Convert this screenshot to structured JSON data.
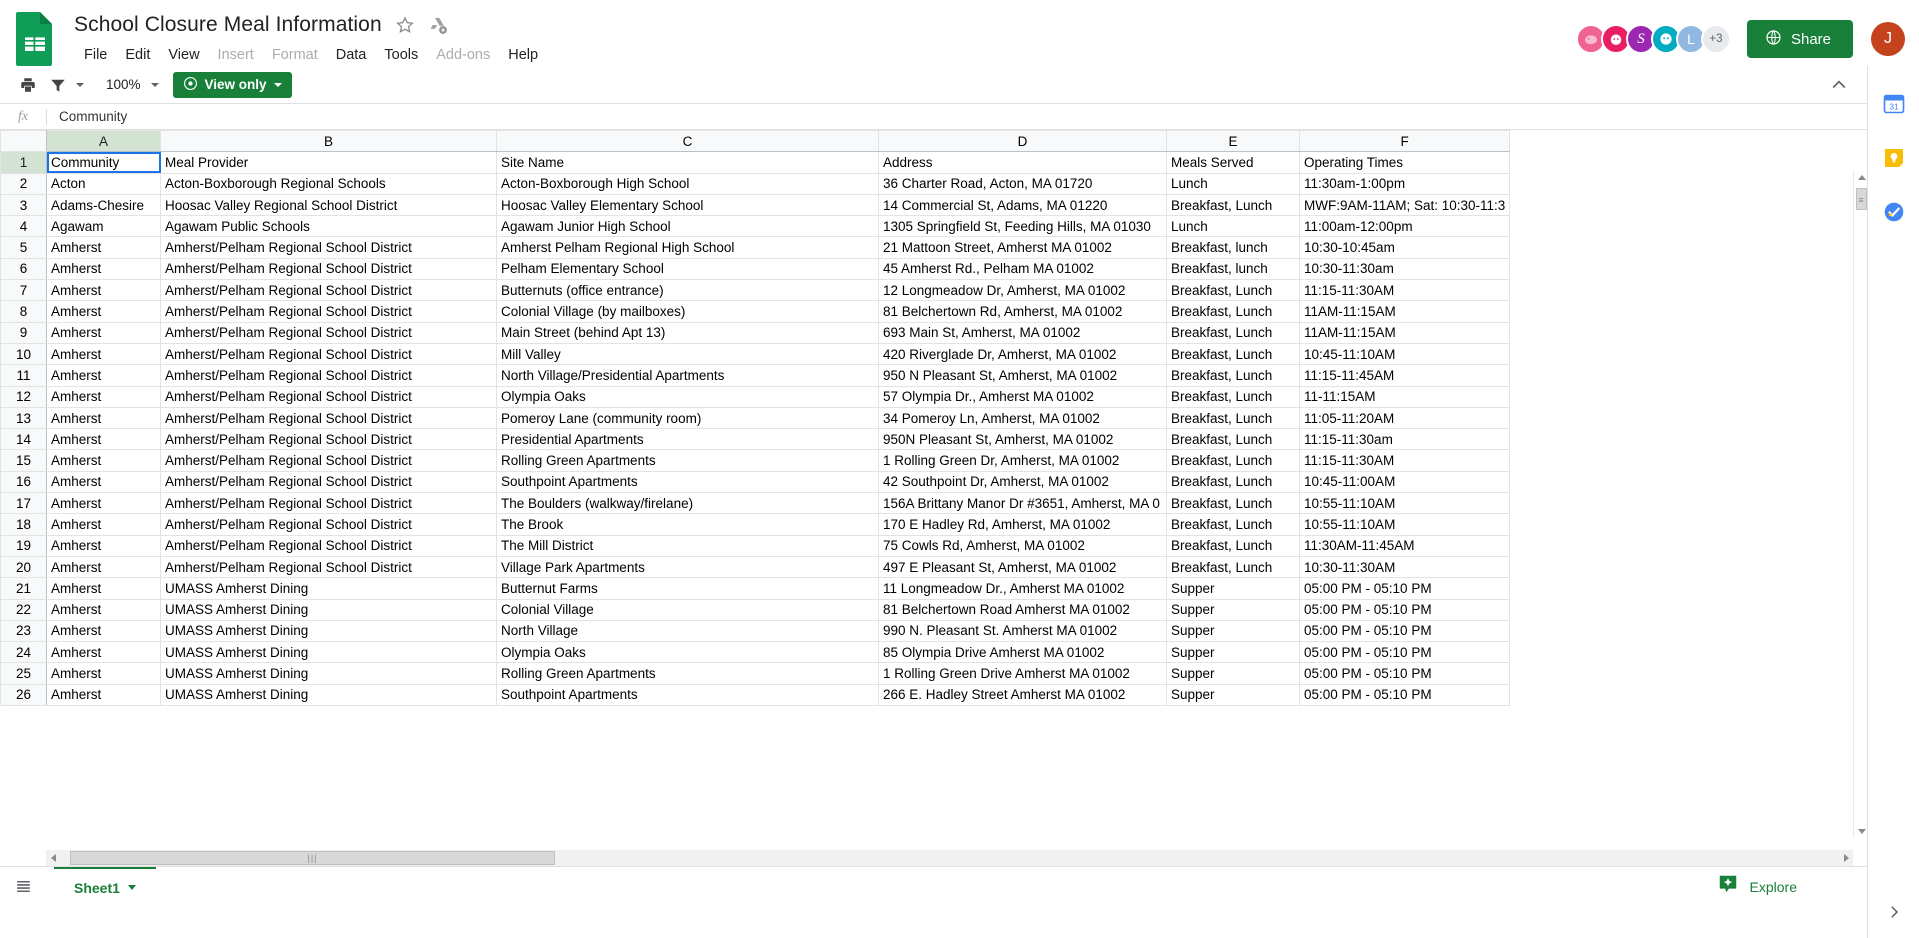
{
  "app": {
    "doc_title": "School Closure Meal Information",
    "logo_icon": "google-sheets-icon",
    "star_icon": "star-outline-icon",
    "drive_icon": "move-to-drive-icon"
  },
  "menubar": {
    "items": [
      {
        "label": "File",
        "enabled": true
      },
      {
        "label": "Edit",
        "enabled": true
      },
      {
        "label": "View",
        "enabled": true
      },
      {
        "label": "Insert",
        "enabled": false
      },
      {
        "label": "Format",
        "enabled": false
      },
      {
        "label": "Data",
        "enabled": true
      },
      {
        "label": "Tools",
        "enabled": true
      },
      {
        "label": "Add-ons",
        "enabled": false
      },
      {
        "label": "Help",
        "enabled": true
      }
    ]
  },
  "collaborators": {
    "avatars": [
      {
        "name": "collaborator-avatar-1",
        "color": "#f06292",
        "glyph": ""
      },
      {
        "name": "collaborator-avatar-2",
        "color": "#e91e63",
        "glyph": ""
      },
      {
        "name": "collaborator-avatar-3",
        "color": "#9c27b0",
        "glyph": "S"
      },
      {
        "name": "collaborator-avatar-4",
        "color": "#00acc1",
        "glyph": ""
      },
      {
        "name": "collaborator-avatar-5",
        "color": "#90b8e0",
        "glyph": "L"
      }
    ],
    "overflow_label": "+3"
  },
  "share": {
    "label": "Share",
    "icon": "globe-icon",
    "color": "#188038"
  },
  "account": {
    "initial": "J",
    "color": "#c5431c"
  },
  "toolbar": {
    "print_icon": "print-icon",
    "filter_icon": "filter-views-icon",
    "zoom_level": "100%",
    "view_only_label": "View only",
    "view_only_icon": "eye-icon",
    "collapse_icon": "chevron-up-icon"
  },
  "formula_bar": {
    "fx_label": "fx",
    "value": "Community"
  },
  "grid": {
    "column_letters": [
      "A",
      "B",
      "C",
      "D",
      "E",
      "F"
    ],
    "selected_column": "A",
    "selected_row": 1,
    "selected_cell": "A1",
    "row_numbers": [
      1,
      2,
      3,
      4,
      5,
      6,
      7,
      8,
      9,
      10,
      11,
      12,
      13,
      14,
      15,
      16,
      17,
      18,
      19,
      20,
      21,
      22,
      23,
      24,
      25,
      26
    ],
    "headers": [
      "Community",
      "Meal Provider",
      "Site Name",
      "Address",
      "Meals Served",
      "Operating Times"
    ],
    "rows": [
      [
        "Acton",
        "Acton-Boxborough Regional Schools",
        "Acton-Boxborough High School",
        "36 Charter Road, Acton, MA 01720",
        "Lunch",
        "11:30am-1:00pm"
      ],
      [
        "Adams-Chesire",
        "Hoosac Valley Regional School District",
        "Hoosac Valley Elementary School",
        "14 Commercial St, Adams, MA 01220",
        "Breakfast, Lunch",
        "MWF:9AM-11AM; Sat: 10:30-11:3"
      ],
      [
        "Agawam",
        "Agawam Public Schools",
        "Agawam Junior High School",
        "1305 Springfield St, Feeding Hills, MA 01030",
        "Lunch",
        "11:00am-12:00pm"
      ],
      [
        "Amherst",
        "Amherst/Pelham Regional School District",
        "Amherst Pelham Regional High School",
        "21 Mattoon Street, Amherst MA 01002",
        "Breakfast, lunch",
        "10:30-10:45am"
      ],
      [
        "Amherst",
        "Amherst/Pelham Regional School District",
        "Pelham Elementary School",
        "45 Amherst Rd., Pelham MA 01002",
        "Breakfast, lunch",
        "10:30-11:30am"
      ],
      [
        "Amherst",
        "Amherst/Pelham Regional School District",
        "Butternuts (office entrance)",
        "12 Longmeadow Dr, Amherst, MA 01002",
        "Breakfast, Lunch",
        "11:15-11:30AM"
      ],
      [
        "Amherst",
        "Amherst/Pelham Regional School District",
        "Colonial Village (by mailboxes)",
        "81 Belchertown Rd, Amherst, MA 01002",
        "Breakfast, Lunch",
        "11AM-11:15AM"
      ],
      [
        "Amherst",
        "Amherst/Pelham Regional School District",
        "Main Street (behind Apt 13)",
        "693 Main St, Amherst, MA 01002",
        "Breakfast, Lunch",
        "11AM-11:15AM"
      ],
      [
        "Amherst",
        "Amherst/Pelham Regional School District",
        "Mill Valley",
        "420 Riverglade Dr, Amherst, MA 01002",
        "Breakfast, Lunch",
        "10:45-11:10AM"
      ],
      [
        "Amherst",
        "Amherst/Pelham Regional School District",
        "North Village/Presidential Apartments",
        "950 N Pleasant St, Amherst, MA 01002",
        "Breakfast, Lunch",
        "11:15-11:45AM"
      ],
      [
        "Amherst",
        "Amherst/Pelham Regional School District",
        "Olympia Oaks",
        "57 Olympia Dr., Amherst MA 01002",
        "Breakfast, Lunch",
        "11-11:15AM"
      ],
      [
        "Amherst",
        "Amherst/Pelham Regional School District",
        "Pomeroy Lane (community room)",
        "34 Pomeroy Ln, Amherst, MA 01002",
        "Breakfast, Lunch",
        "11:05-11:20AM"
      ],
      [
        "Amherst",
        "Amherst/Pelham Regional School District",
        "Presidential Apartments",
        "950N Pleasant St, Amherst, MA 01002",
        "Breakfast, Lunch",
        "11:15-11:30am"
      ],
      [
        "Amherst",
        "Amherst/Pelham Regional School District",
        "Rolling Green Apartments",
        "1 Rolling Green Dr, Amherst, MA 01002",
        "Breakfast, Lunch",
        "11:15-11:30AM"
      ],
      [
        "Amherst",
        "Amherst/Pelham Regional School District",
        "Southpoint Apartments",
        "42 Southpoint Dr, Amherst, MA 01002",
        "Breakfast, Lunch",
        "10:45-11:00AM"
      ],
      [
        "Amherst",
        "Amherst/Pelham Regional School District",
        "The Boulders (walkway/firelane)",
        "156A Brittany Manor Dr #3651, Amherst, MA 0",
        "Breakfast, Lunch",
        "10:55-11:10AM"
      ],
      [
        "Amherst",
        "Amherst/Pelham Regional School District",
        "The Brook",
        "170 E Hadley Rd, Amherst, MA 01002",
        "Breakfast, Lunch",
        "10:55-11:10AM"
      ],
      [
        "Amherst",
        "Amherst/Pelham Regional School District",
        "The Mill District",
        "75 Cowls Rd, Amherst, MA 01002",
        "Breakfast, Lunch",
        "11:30AM-11:45AM"
      ],
      [
        "Amherst",
        "Amherst/Pelham Regional School District",
        "Village Park Apartments",
        "497 E Pleasant St, Amherst, MA 01002",
        "Breakfast, Lunch",
        "10:30-11:30AM"
      ],
      [
        "Amherst",
        "UMASS Amherst Dining",
        "Butternut Farms",
        "11 Longmeadow Dr., Amherst MA 01002",
        "Supper",
        "05:00 PM - 05:10 PM"
      ],
      [
        "Amherst",
        "UMASS Amherst Dining",
        "Colonial Village",
        "81 Belchertown Road Amherst MA 01002",
        "Supper",
        "05:00 PM - 05:10 PM"
      ],
      [
        "Amherst",
        "UMASS Amherst Dining",
        "North Village",
        "990 N. Pleasant St. Amherst MA 01002",
        "Supper",
        "05:00 PM - 05:10 PM"
      ],
      [
        "Amherst",
        "UMASS Amherst Dining",
        "Olympia Oaks",
        "85 Olympia Drive Amherst MA 01002",
        "Supper",
        "05:00 PM - 05:10 PM"
      ],
      [
        "Amherst",
        "UMASS Amherst Dining",
        "Rolling Green Apartments",
        "1 Rolling Green Drive Amherst MA 01002",
        "Supper",
        "05:00 PM - 05:10 PM"
      ],
      [
        "Amherst",
        "UMASS Amherst Dining",
        "Southpoint Apartments",
        "266 E. Hadley Street Amherst MA 01002",
        "Supper",
        "05:00 PM - 05:10 PM"
      ]
    ]
  },
  "bottom": {
    "all_sheets_icon": "all-sheets-icon",
    "sheet_tab_label": "Sheet1",
    "sheet_tab_caret": "chevron-down-icon",
    "explore_label": "Explore",
    "explore_icon": "explore-sparkle-icon"
  },
  "right_rail": {
    "icons": [
      {
        "name": "google-calendar-icon",
        "label": "31"
      },
      {
        "name": "google-keep-icon",
        "label": ""
      },
      {
        "name": "google-tasks-icon",
        "label": ""
      }
    ],
    "expand_icon": "chevron-right-icon"
  }
}
